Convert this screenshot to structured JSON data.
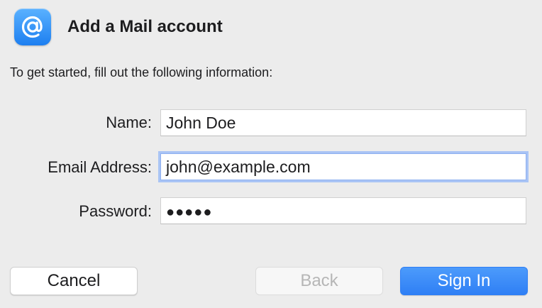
{
  "dialog": {
    "title": "Add a Mail account",
    "icon": "at-sign-icon",
    "intro": "To get started, fill out the following information:"
  },
  "form": {
    "name_label": "Name:",
    "name_value": "John Doe",
    "email_label": "Email Address:",
    "email_value": "john@example.com",
    "password_label": "Password:",
    "password_value": "●●●●●"
  },
  "buttons": {
    "cancel_label": "Cancel",
    "back_label": "Back",
    "signin_label": "Sign In"
  },
  "colors": {
    "accent": "#2f7ff5",
    "focus_ring": "#a9c4f5",
    "disabled_text": "#b6b6b6"
  }
}
